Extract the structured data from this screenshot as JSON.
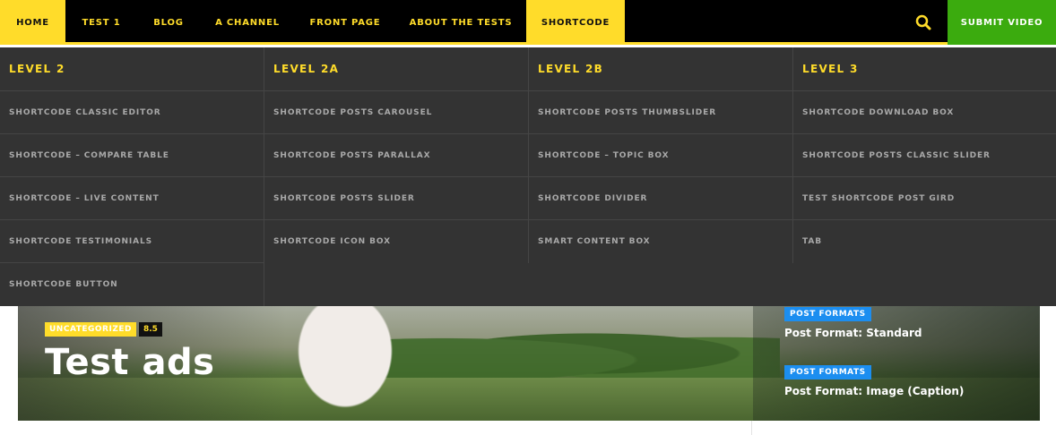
{
  "nav": {
    "items": [
      {
        "label": "HOME",
        "active": true
      },
      {
        "label": "TEST 1",
        "active": false
      },
      {
        "label": "BLOG",
        "active": false
      },
      {
        "label": "A CHANNEL",
        "active": false
      },
      {
        "label": "FRONT PAGE",
        "active": false
      },
      {
        "label": "ABOUT THE TESTS",
        "active": false
      },
      {
        "label": "SHORTCODE",
        "active": true
      }
    ],
    "search_icon": "search-icon",
    "submit_label": "SUBMIT VIDEO"
  },
  "colors": {
    "accent": "#ffdc2a",
    "submit": "#3bab0e",
    "menu_bg": "#333333",
    "post_format_badge": "#1c8ef0"
  },
  "mega_menu": {
    "columns": [
      {
        "heading": "LEVEL 2",
        "links": [
          "SHORTCODE CLASSIC EDITOR",
          "SHORTCODE – COMPARE TABLE",
          "SHORTCODE – LIVE CONTENT",
          "SHORTCODE TESTIMONIALS",
          "SHORTCODE BUTTON"
        ]
      },
      {
        "heading": "LEVEL 2A",
        "links": [
          "SHORTCODE POSTS CAROUSEL",
          "SHORTCODE POSTS PARALLAX",
          "SHORTCODE POSTS SLIDER",
          "SHORTCODE ICON BOX"
        ]
      },
      {
        "heading": "LEVEL 2B",
        "links": [
          "SHORTCODE POSTS THUMBSLIDER",
          "SHORTCODE – TOPIC BOX",
          "SHORTCODE DIVIDER",
          "SMART CONTENT BOX"
        ]
      },
      {
        "heading": "LEVEL 3",
        "links": [
          "SHORTCODE DOWNLOAD BOX",
          "SHORTCODE POSTS CLASSIC SLIDER",
          "TEST SHORTCODE POST GIRD",
          "TAB"
        ]
      }
    ]
  },
  "hero": {
    "category": "UNCATEGORIZED",
    "score": "8.5",
    "title": "Test ads"
  },
  "side_posts": [
    {
      "badge": "POST FORMATS",
      "title": "Post Format: Standard"
    },
    {
      "badge": "POST FORMATS",
      "title": "Post Format: Image (Caption)"
    }
  ]
}
